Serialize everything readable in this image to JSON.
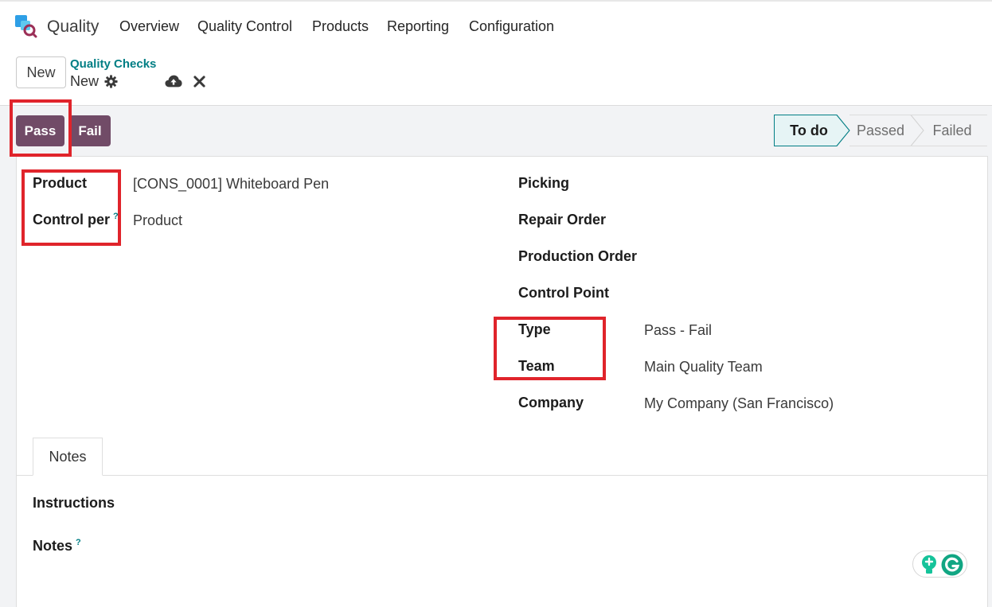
{
  "navbar": {
    "app_name": "Quality",
    "items": [
      "Overview",
      "Quality Control",
      "Products",
      "Reporting",
      "Configuration"
    ]
  },
  "control_panel": {
    "new_label": "New",
    "breadcrumb_parent": "Quality Checks",
    "breadcrumb_current": "New"
  },
  "actions": {
    "pass_label": "Pass",
    "fail_label": "Fail"
  },
  "statusbar": {
    "stages": [
      "To do",
      "Passed",
      "Failed"
    ],
    "active": "To do"
  },
  "form": {
    "left": {
      "product_label": "Product",
      "product_value": "[CONS_0001] Whiteboard Pen",
      "control_per_label": "Control per",
      "control_per_value": "Product"
    },
    "right": {
      "picking_label": "Picking",
      "repair_order_label": "Repair Order",
      "production_order_label": "Production Order",
      "control_point_label": "Control Point",
      "type_label": "Type",
      "type_value": "Pass - Fail",
      "team_label": "Team",
      "team_value": "Main Quality Team",
      "company_label": "Company",
      "company_value": "My Company (San Francisco)"
    },
    "help_marker": "?"
  },
  "notebook": {
    "tab_label": "Notes",
    "instructions_label": "Instructions",
    "notes_label": "Notes"
  },
  "colors": {
    "primary": "#714b67",
    "link": "#017e84",
    "highlight": "#e0242b",
    "status_active_bg": "#e6f4f5"
  }
}
